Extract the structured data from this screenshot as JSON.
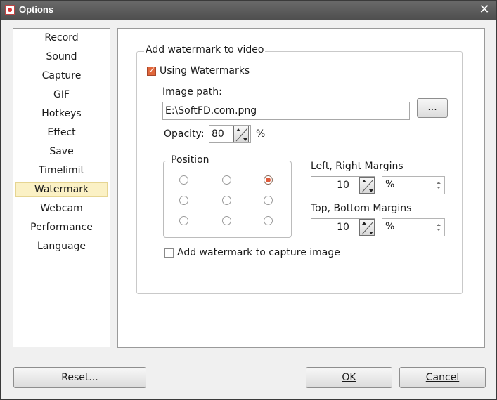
{
  "window": {
    "title": "Options"
  },
  "nav": {
    "items": [
      {
        "label": "Record"
      },
      {
        "label": "Sound"
      },
      {
        "label": "Capture"
      },
      {
        "label": "GIF"
      },
      {
        "label": "Hotkeys"
      },
      {
        "label": "Effect"
      },
      {
        "label": "Save"
      },
      {
        "label": "Timelimit"
      },
      {
        "label": "Watermark",
        "selected": true
      },
      {
        "label": "Webcam"
      },
      {
        "label": "Performance"
      },
      {
        "label": "Language"
      }
    ]
  },
  "watermark": {
    "group_title": "Add watermark to video",
    "using_watermarks_label": "Using Watermarks",
    "using_watermarks_checked": true,
    "image_path_label": "Image path:",
    "image_path_value": "E:\\SoftFD.com.png",
    "browse_label": "...",
    "opacity_label": "Opacity:",
    "opacity_value": "80",
    "opacity_unit": "%",
    "position_title": "Position",
    "position_selected": "top-right",
    "lr_margins_label": "Left, Right Margins",
    "lr_margin_value": "10",
    "lr_margin_unit": "%",
    "tb_margins_label": "Top, Bottom Margins",
    "tb_margin_value": "10",
    "tb_margin_unit": "%",
    "capture_image_label": "Add watermark to capture image",
    "capture_image_checked": false
  },
  "footer": {
    "reset_label": "Reset...",
    "ok_label": "OK",
    "cancel_label": "Cancel"
  }
}
